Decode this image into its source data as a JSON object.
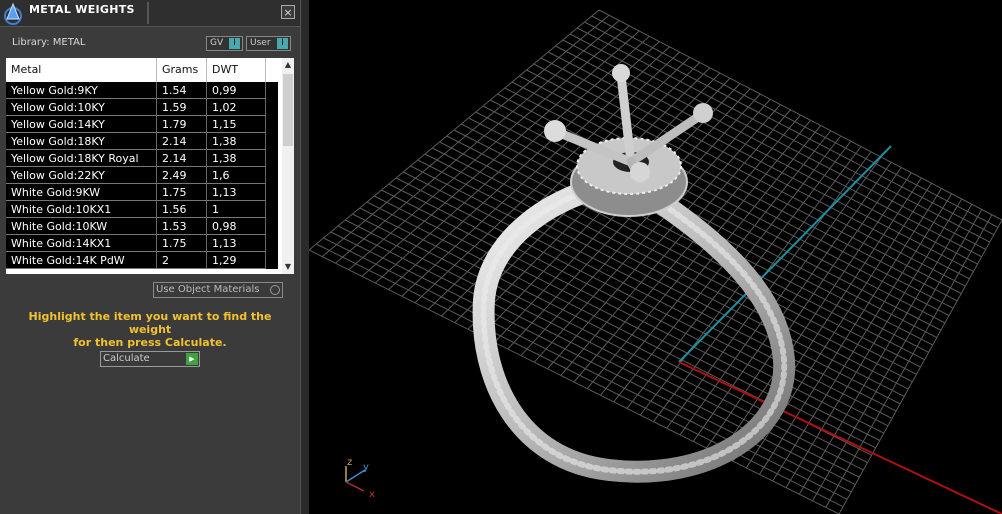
{
  "titlebar": {
    "title": "METAL WEIGHTS",
    "close_label": "×"
  },
  "library": {
    "label": "Library: METAL"
  },
  "toggles": {
    "gv": "GV",
    "user": "User",
    "knob": "I"
  },
  "table": {
    "columns": [
      "Metal",
      "Grams",
      "DWT"
    ],
    "rows": [
      [
        "Yellow Gold:9KY",
        "1.54",
        "0,99"
      ],
      [
        "Yellow Gold:10KY",
        "1.59",
        "1,02"
      ],
      [
        "Yellow Gold:14KY",
        "1.79",
        "1,15"
      ],
      [
        "Yellow Gold:18KY",
        "2.14",
        "1,38"
      ],
      [
        "Yellow Gold:18KY Royal",
        "2.14",
        "1,38"
      ],
      [
        "Yellow Gold:22KY",
        "2.49",
        "1,6"
      ],
      [
        "White Gold:9KW",
        "1.75",
        "1,13"
      ],
      [
        "White Gold:10KX1",
        "1.56",
        "1"
      ],
      [
        "White Gold:10KW",
        "1.53",
        "0,98"
      ],
      [
        "White Gold:14KX1",
        "1.75",
        "1,13"
      ],
      [
        "White Gold:14K PdW",
        "2",
        "1,29"
      ]
    ]
  },
  "use_object_materials": "Use Object Materials",
  "hint": {
    "line1": "Highlight the item you want to find the weight",
    "line2": "for then press Calculate."
  },
  "calculate_label": "Calculate",
  "axes": {
    "z": "z",
    "y": "y",
    "x": "x"
  },
  "colors": {
    "panel": "#3b3b3b",
    "hint": "#f2c22f",
    "toggle_knob": "#4aa7ad",
    "x_axis": "#b01010",
    "y_axis": "#1e8fa0",
    "grid": "#5a5a5a"
  }
}
